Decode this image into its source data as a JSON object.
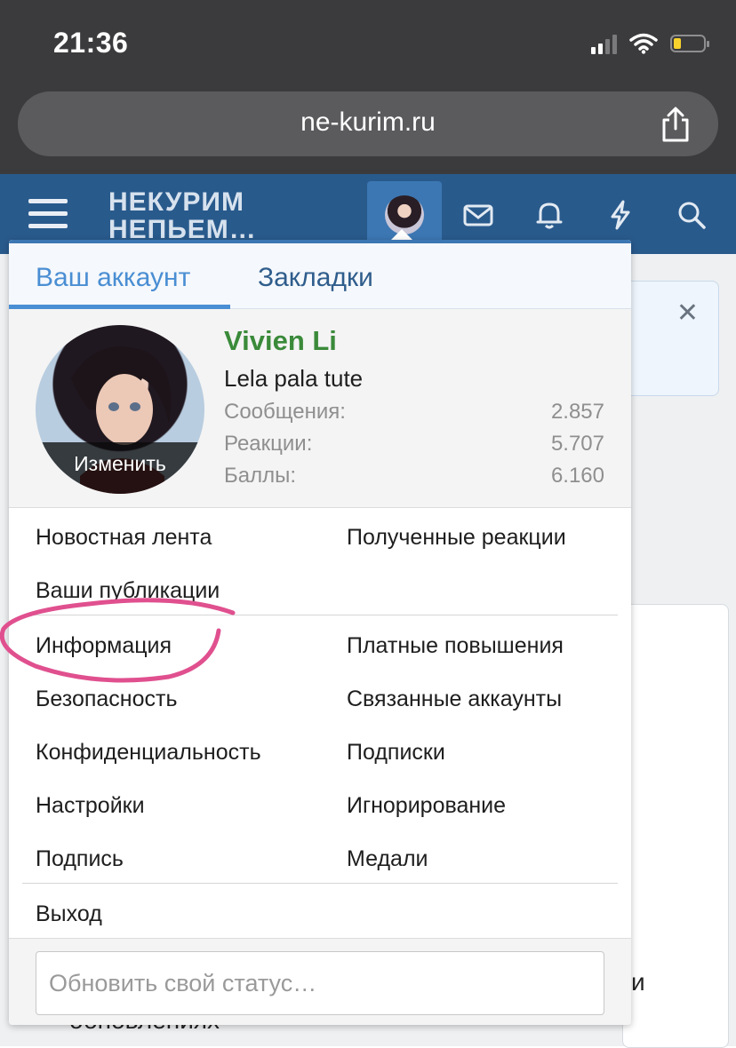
{
  "status_bar": {
    "time": "21:36"
  },
  "browser": {
    "url": "ne-kurim.ru"
  },
  "site_header": {
    "logo_line1": "НЕКУРИМ",
    "logo_line2": "НЕПЬЕМ…"
  },
  "popup": {
    "tabs": [
      {
        "label": "Ваш аккаунт",
        "active": true
      },
      {
        "label": "Закладки",
        "active": false
      }
    ],
    "profile": {
      "name": "Vivien Li",
      "user_title": "Lela pala tute",
      "avatar_action": "Изменить",
      "stats": [
        {
          "label": "Сообщения:",
          "value": "2.857"
        },
        {
          "label": "Реакции:",
          "value": "5.707"
        },
        {
          "label": "Баллы:",
          "value": "6.160"
        }
      ]
    },
    "menu_group1": {
      "news_feed": "Новостная лента",
      "reactions_received": "Полученные реакции",
      "your_content": "Ваши публикации"
    },
    "menu_group2": {
      "account_details": "Информация",
      "paid_upgrades": "Платные повышения",
      "security": "Безопасность",
      "connected_accounts": "Связанные аккаунты",
      "privacy": "Конфиденциальность",
      "following": "Подписки",
      "preferences": "Настройки",
      "ignoring": "Игнорирование",
      "signature": "Подпись",
      "medals": "Медали"
    },
    "logout": "Выход",
    "status_placeholder": "Обновить свой статус…"
  },
  "background": {
    "text_right": "к и",
    "text_bottom": "обновлениях"
  },
  "colors": {
    "header": "#295a8c",
    "accent_tab": "#4a8ed3",
    "username": "#3a8a3a",
    "annotation": "#e0508f"
  }
}
